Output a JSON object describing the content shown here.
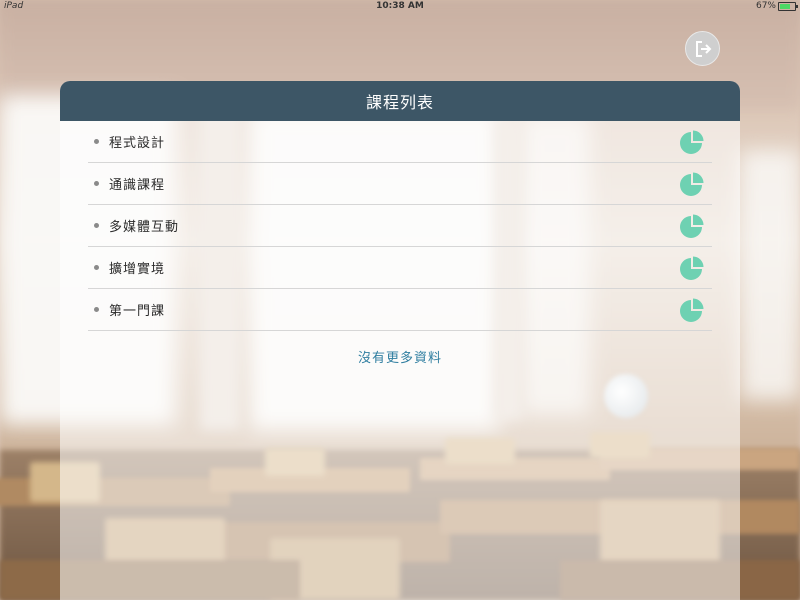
{
  "status_bar": {
    "carrier": "iPad",
    "time": "10:38 AM",
    "battery_text": "67%"
  },
  "header": {
    "title": "課程列表",
    "logout_icon": "logout-icon"
  },
  "courses": [
    {
      "name": "程式設計",
      "icon": "pie-chart-icon"
    },
    {
      "name": "通識課程",
      "icon": "pie-chart-icon"
    },
    {
      "name": "多媒體互動",
      "icon": "pie-chart-icon"
    },
    {
      "name": "擴增實境",
      "icon": "pie-chart-icon"
    },
    {
      "name": "第一門課",
      "icon": "pie-chart-icon"
    }
  ],
  "footer_note": "沒有更多資料",
  "colors": {
    "header_bg": "#3d5666",
    "icon_green": "#6ed1b2",
    "link_blue": "#2f7ea0"
  }
}
